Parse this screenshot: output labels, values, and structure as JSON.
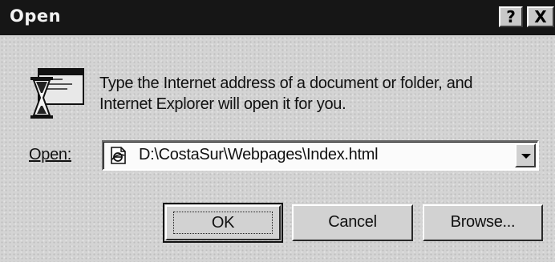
{
  "window": {
    "title": "Open",
    "help_button": "?",
    "close_button": "X"
  },
  "message": {
    "line1": "Type the Internet address of a document or folder, and",
    "line2": "Internet Explorer will open it for you."
  },
  "open_field": {
    "label": "Open:",
    "value": "D:\\CostaSur\\Webpages\\Index.html"
  },
  "buttons": {
    "ok": "OK",
    "cancel": "Cancel",
    "browse": "Browse..."
  }
}
